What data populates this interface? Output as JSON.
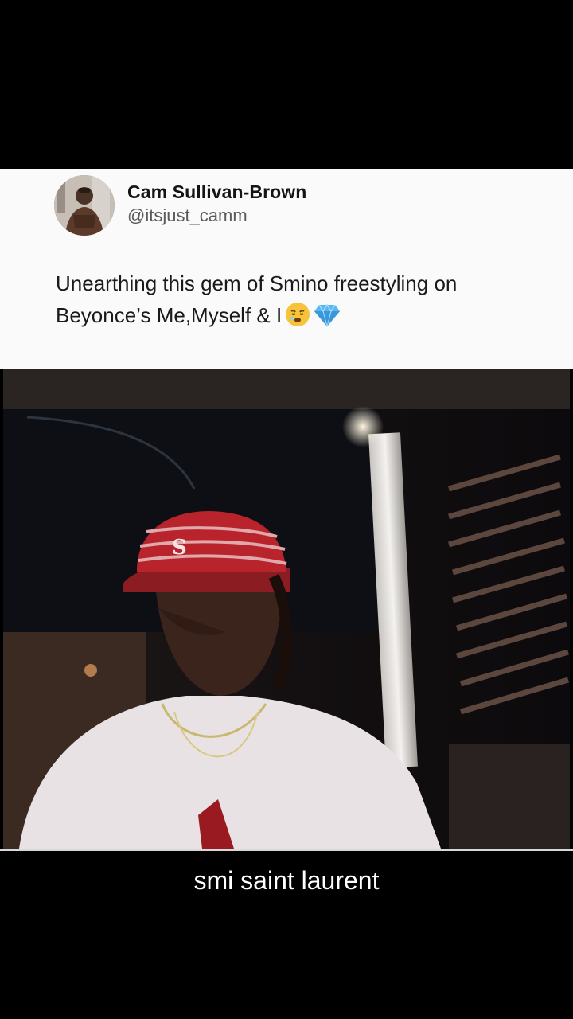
{
  "tweet": {
    "author_name": "Cam Sullivan-Brown",
    "author_handle": "@itsjust_camm",
    "text_line1": "Unearthing this gem of Smino freestyling on",
    "text_line2": "Beyonce’s Me,Myself & I",
    "emojis": [
      "weary-face-emoji",
      "gem-stone-emoji"
    ]
  },
  "video": {
    "content": "man-in-red-striped-cap-and-white-tshirt"
  },
  "caption": "smi saint laurent",
  "colors": {
    "card_bg": "#fafafa",
    "page_bg": "#000000",
    "name_color": "#141414",
    "handle_color": "#5a5a5a",
    "cap_red": "#b8232c"
  }
}
